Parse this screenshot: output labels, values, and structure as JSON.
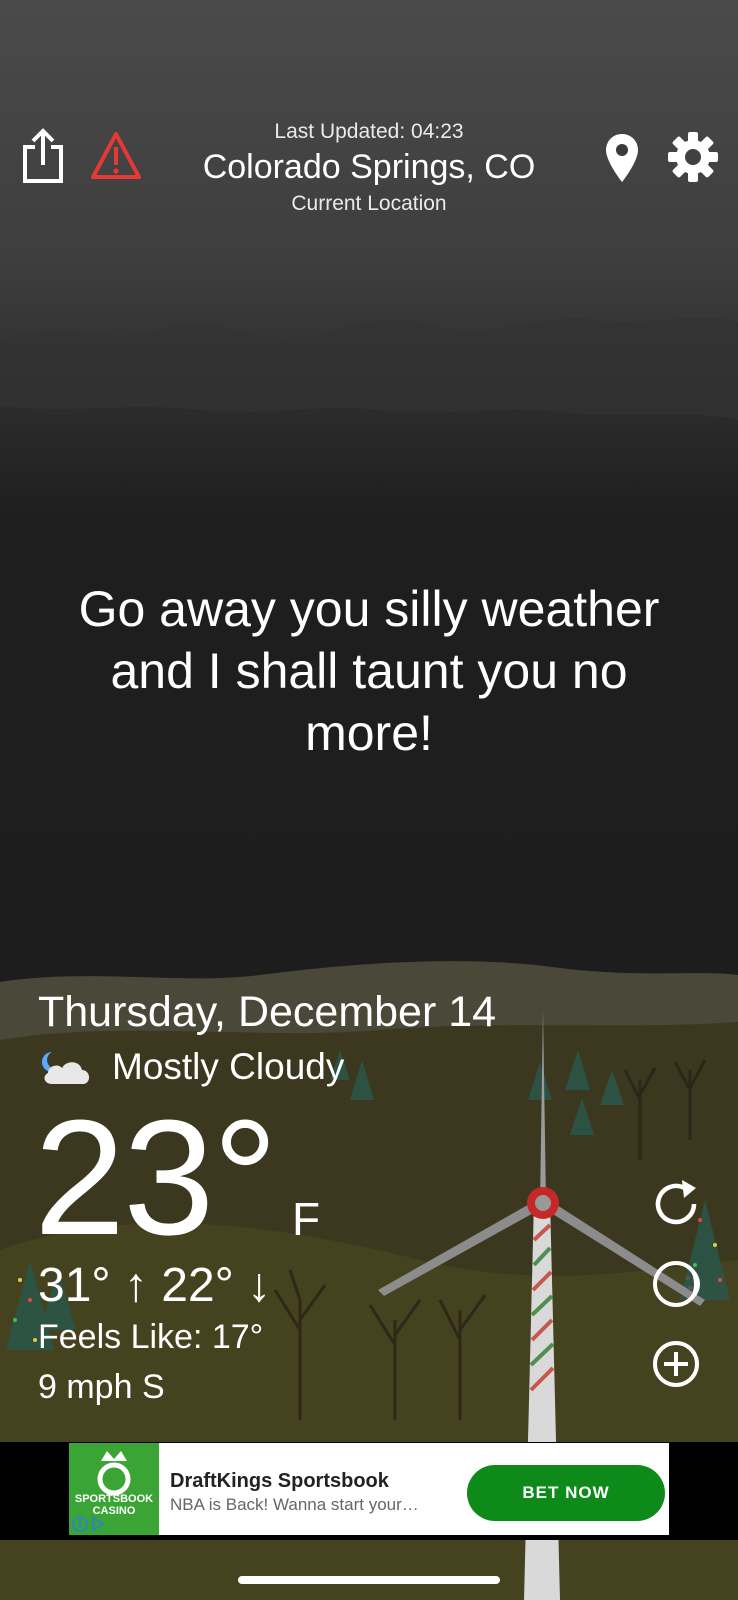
{
  "header": {
    "last_updated": "Last Updated: 04:23",
    "city": "Colorado Springs, CO",
    "location_label": "Current Location",
    "icons": [
      "share-icon",
      "alert-icon",
      "location-pin-icon",
      "gear-icon"
    ]
  },
  "quote": "Go away you silly weather and I shall taunt you no more!",
  "weather": {
    "date": "Thursday, December 14",
    "condition": "Mostly Cloudy",
    "condition_icon": "moon-cloud-icon",
    "temperature": "23°",
    "unit": "F",
    "hi_lo": "31° ↑ 22° ↓",
    "feels_like": "Feels Like: 17°",
    "wind": "9 mph S"
  },
  "side_actions": [
    "refresh-icon",
    "moon-phase-icon",
    "add-icon"
  ],
  "ad": {
    "title": "DraftKings Sportsbook",
    "subtitle": "NBA is Back! Wanna start your…",
    "button": "BET NOW",
    "logo_text": "SPORTSBOOK CASINO"
  },
  "colors": {
    "alert": "#e53935",
    "ad_button": "#0d8a1a",
    "ad_logo": "#3aa535",
    "ground": "#3d3a22"
  }
}
